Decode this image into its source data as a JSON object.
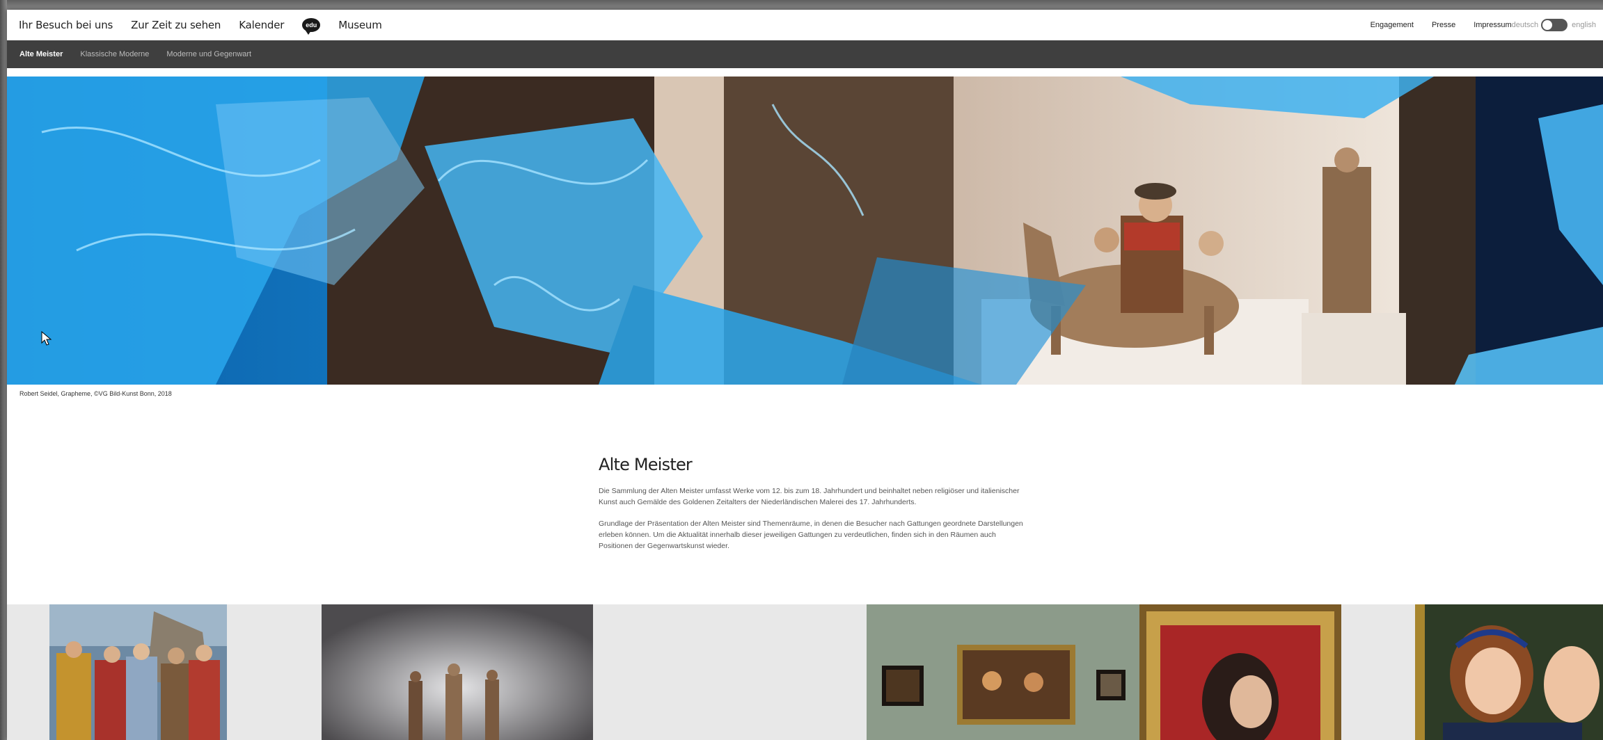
{
  "nav": {
    "main": [
      {
        "label": "Ihr Besuch bei uns"
      },
      {
        "label": "Zur Zeit zu sehen"
      },
      {
        "label": "Kalender"
      }
    ],
    "edu_icon": "edu",
    "museum_label": "Museum",
    "secondary": {
      "engagement": "Engagement",
      "presse": "Presse",
      "impressum": "Impressum"
    },
    "language": {
      "deutsch": "deutsch",
      "english": "english"
    }
  },
  "subnav": {
    "items": [
      {
        "label": "Alte Meister"
      },
      {
        "label": "Klassische Moderne"
      },
      {
        "label": "Moderne und Gegenwart"
      }
    ]
  },
  "hero": {
    "caption": "Robert Seidel, Grapheme, ©VG Bild-Kunst Bonn, 2018"
  },
  "content": {
    "title": "Alte Meister",
    "paragraph1": "Die Sammlung der Alten Meister umfasst Werke vom 12. bis zum 18. Jahrhundert und beinhaltet neben religiöser und italienischer Kunst auch Gemälde des Goldenen Zeitalters der Niederländischen Malerei des 17. Jahrhunderts.",
    "paragraph2": "Grundlage der Präsentation der Alten Meister sind Themenräume, in denen die Besucher nach Gattungen geordnete Darstellungen erleben können. Um die Aktualität innerhalb dieser jeweiligen Gattungen zu verdeutlichen, finden sich in den Räumen auch Positionen der Gegenwartskunst wieder."
  },
  "colors": {
    "subnav_bg": "#3f3f3f",
    "hero_blue": "#0b6fb8"
  },
  "icons": {
    "edu": "edu-speech-bubble-icon",
    "cursor": "mouse-cursor-icon",
    "toggle": "language-toggle"
  }
}
